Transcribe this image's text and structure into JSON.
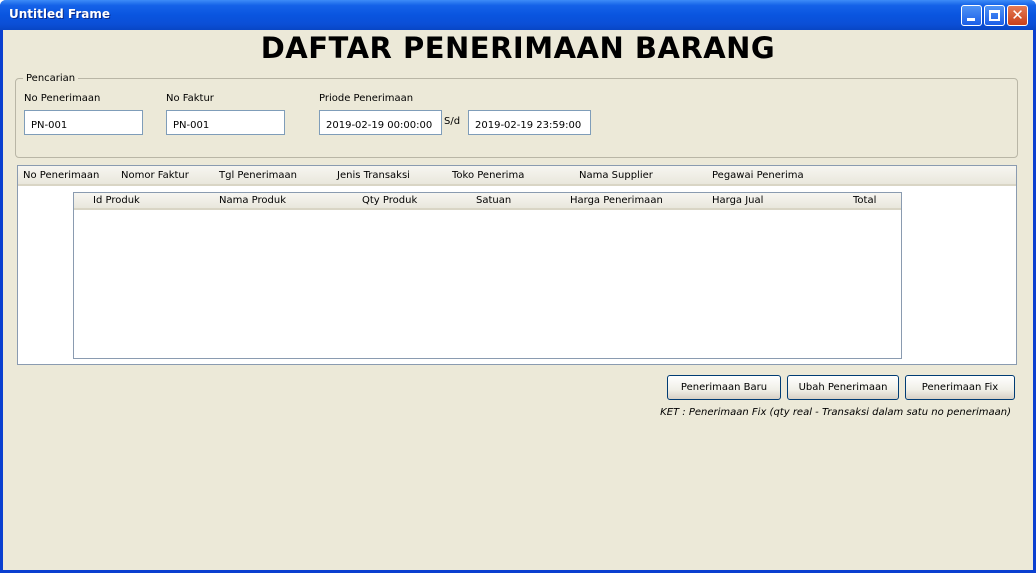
{
  "window": {
    "title": "Untitled Frame"
  },
  "title_buttons": {
    "minimize": "minimize-icon",
    "maximize": "maximize-icon",
    "close": "close-icon",
    "close_glyph": "✕"
  },
  "heading": "DAFTAR PENERIMAAN BARANG",
  "search": {
    "legend": "Pencarian",
    "no_penerimaan_label": "No Penerimaan",
    "no_penerimaan_value": "PN-001",
    "no_faktur_label": "No Faktur",
    "no_faktur_value": "PN-001",
    "periode_label": "Priode Penerimaan",
    "periode_from": "2019-02-19 00:00:00",
    "sd_label": "S/d",
    "periode_to": "2019-02-19 23:59:00"
  },
  "outer_table": {
    "columns": [
      "No Penerimaan",
      "Nomor Faktur",
      "Tgl Penerimaan",
      "Jenis Transaksi",
      "Toko Penerima",
      "Nama Supplier",
      "Pegawai Penerima"
    ],
    "rows": []
  },
  "inner_table": {
    "columns": [
      "Id Produk",
      "Nama Produk",
      "Qty Produk",
      "Satuan",
      "Harga Penerimaan",
      "Harga Jual",
      "Total"
    ],
    "rows": []
  },
  "buttons": {
    "baru": "Penerimaan Baru",
    "ubah": "Ubah Penerimaan",
    "fix": "Penerimaan Fix"
  },
  "note": "KET : Penerimaan Fix (qty real - Transaksi dalam satu no penerimaan)",
  "colors": {
    "titlebar": "#0a55e0",
    "window_bg": "#ece9d8",
    "field_border": "#7f9db9",
    "button_border": "#003c74"
  }
}
